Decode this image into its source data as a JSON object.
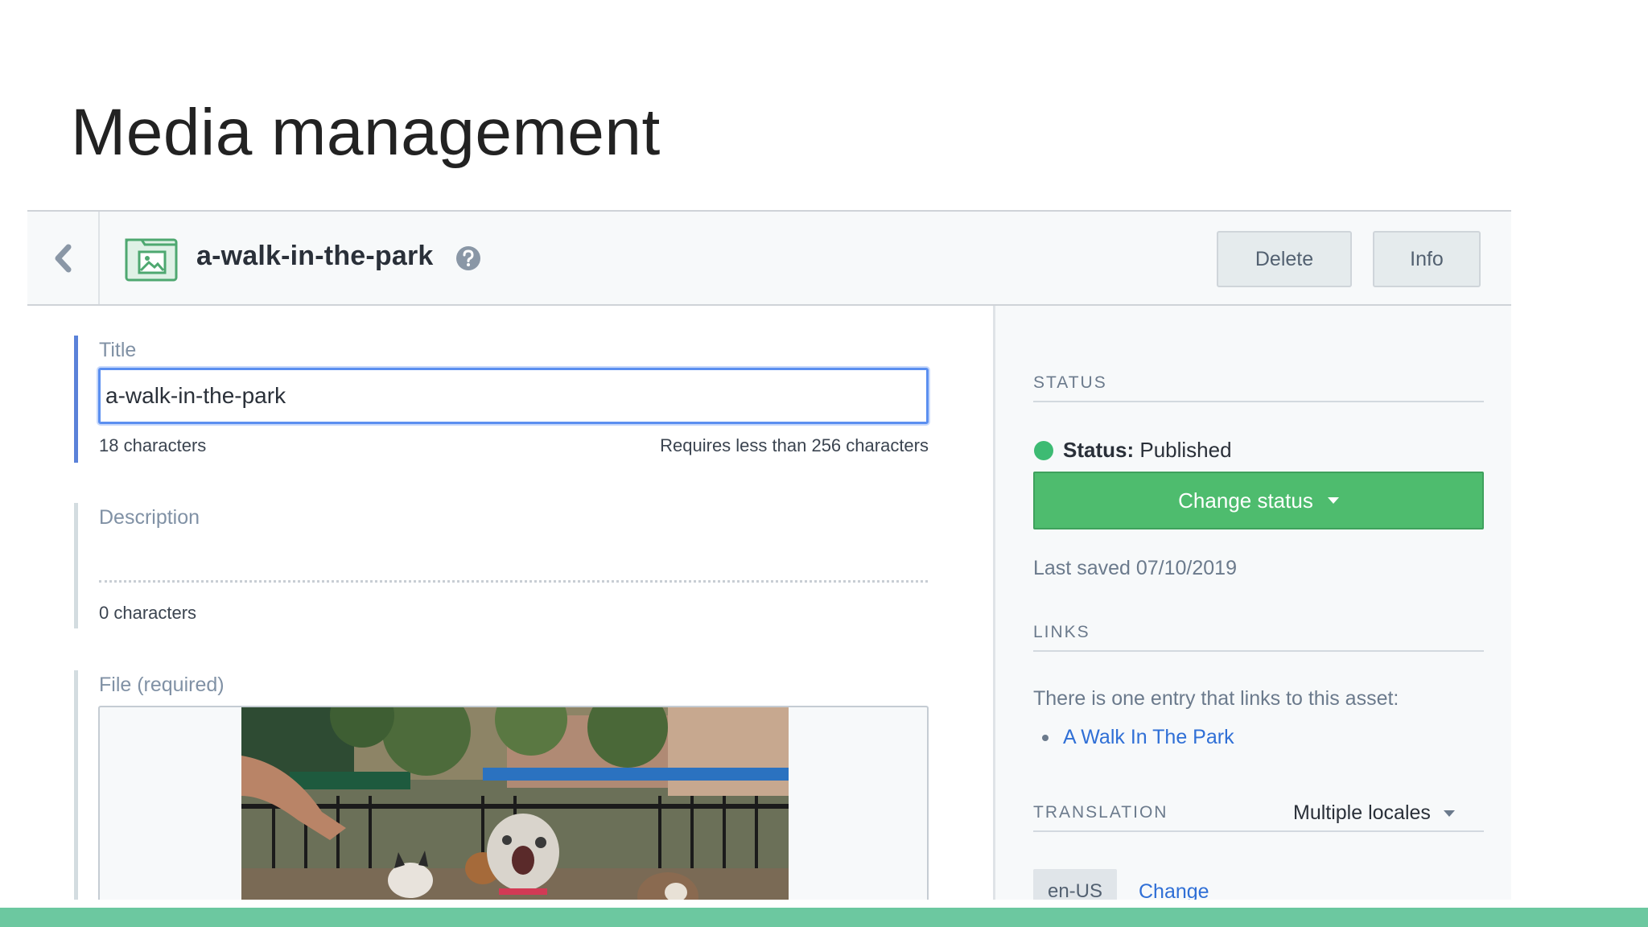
{
  "slide": {
    "title": "Media management"
  },
  "header": {
    "entry_title": "a-walk-in-the-park",
    "delete_label": "Delete",
    "info_label": "Info"
  },
  "fields": {
    "title": {
      "label": "Title",
      "value": "a-walk-in-the-park",
      "count": "18 characters",
      "limit": "Requires less than 256 characters"
    },
    "description": {
      "label": "Description",
      "count": "0 characters"
    },
    "file": {
      "label": "File (required)"
    }
  },
  "sidebar": {
    "status_heading": "STATUS",
    "status_key": "Status:",
    "status_value": "Published",
    "change_status_label": "Change status",
    "last_saved": "Last saved 07/10/2019",
    "links_heading": "LINKS",
    "links_text": "There is one entry that links to this asset:",
    "links": [
      "A Walk In The Park"
    ],
    "translation_heading": "TRANSLATION",
    "locale_mode": "Multiple locales",
    "locale_tag": "en-US",
    "change_label": "Change"
  },
  "colors": {
    "accent_blue": "#5b82d9",
    "status_green": "#3dbb73",
    "button_green": "#4ebc6e",
    "link_blue": "#2f6fd6",
    "bottom_band": "#6cc8a0"
  }
}
